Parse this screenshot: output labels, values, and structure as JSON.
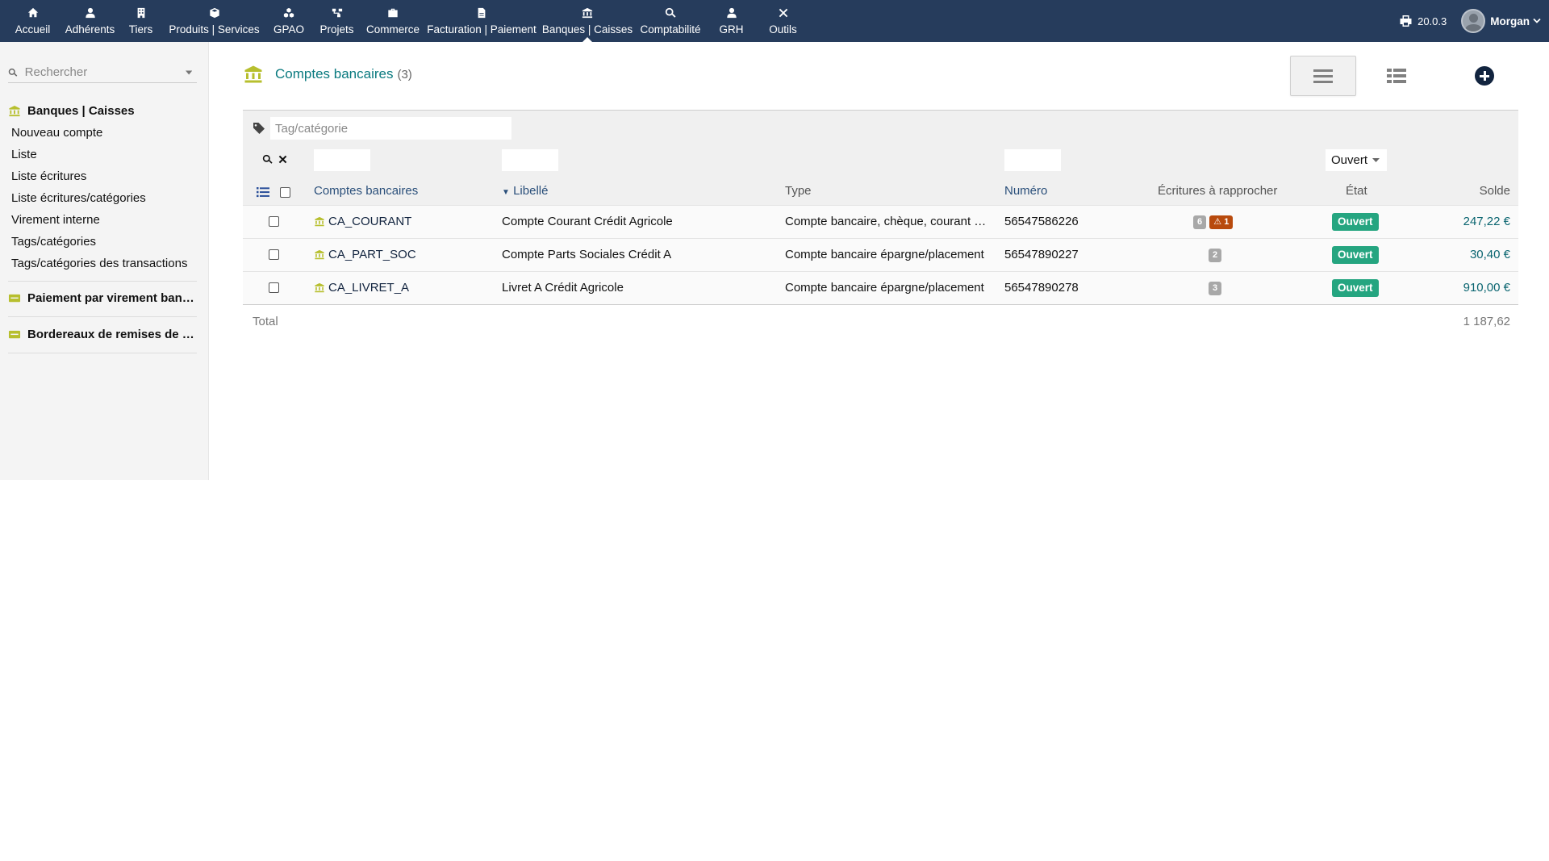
{
  "topbar": {
    "menu": [
      {
        "label": "Accueil",
        "icon": "home-icon"
      },
      {
        "label": "Adhérents",
        "icon": "user-icon"
      },
      {
        "label": "Tiers",
        "icon": "building-icon"
      },
      {
        "label": "Produits | Services",
        "icon": "cube-icon"
      },
      {
        "label": "GPAO",
        "icon": "cubes-icon"
      },
      {
        "label": "Projets",
        "icon": "sitemap-icon"
      },
      {
        "label": "Commerce",
        "icon": "briefcase-icon"
      },
      {
        "label": "Facturation | Paiement",
        "icon": "file-invoice-icon"
      },
      {
        "label": "Banques | Caisses",
        "icon": "bank-icon"
      },
      {
        "label": "Comptabilité",
        "icon": "search-dollar-icon"
      },
      {
        "label": "GRH",
        "icon": "user-tie-icon"
      },
      {
        "label": "Outils",
        "icon": "tools-icon"
      }
    ],
    "version": "20.0.3",
    "user": "Morgan"
  },
  "sidebar": {
    "search_placeholder": "Rechercher",
    "section1": {
      "title": "Banques | Caisses",
      "links": [
        "Nouveau compte",
        "Liste",
        "Liste écritures",
        "Liste écritures/catégories",
        "Virement interne",
        "Tags/catégories",
        "Tags/catégories des transactions"
      ]
    },
    "section2_title": "Paiement par virement bancaire",
    "section3_title": "Bordereaux de remises de chèques"
  },
  "main": {
    "title": "Comptes bancaires",
    "count": "(3)",
    "tag_placeholder": "Tag/catégorie",
    "state_filter": "Ouvert",
    "columns": {
      "ref": "Comptes bancaires",
      "label": "Libellé",
      "type": "Type",
      "number": "Numéro",
      "reconcile": "Écritures à rapprocher",
      "state": "État",
      "balance": "Solde"
    },
    "rows": [
      {
        "ref": "CA_COURANT",
        "label": "Compte Courant Crédit Agricole",
        "type": "Compte bancaire, chèque, courant …",
        "number": "56547586226",
        "reconcile": "6",
        "warning": "1",
        "state": "Ouvert",
        "balance": "247,22 €"
      },
      {
        "ref": "CA_PART_SOC",
        "label": "Compte Parts Sociales Crédit A",
        "type": "Compte bancaire épargne/placement",
        "number": "56547890227",
        "reconcile": "2",
        "state": "Ouvert",
        "balance": "30,40 €"
      },
      {
        "ref": "CA_LIVRET_A",
        "label": "Livret A Crédit Agricole",
        "type": "Compte bancaire épargne/placement",
        "number": "56547890278",
        "reconcile": "3",
        "state": "Ouvert",
        "balance": "910,00 €"
      }
    ],
    "total_label": "Total",
    "total_value": "1 187,62"
  },
  "colors": {
    "topbar": "#263c5c",
    "accent_teal": "#0a7a7f",
    "bank_icon": "#b7bf2e",
    "open_badge": "#25a580",
    "warning_badge": "#b84a0d"
  }
}
